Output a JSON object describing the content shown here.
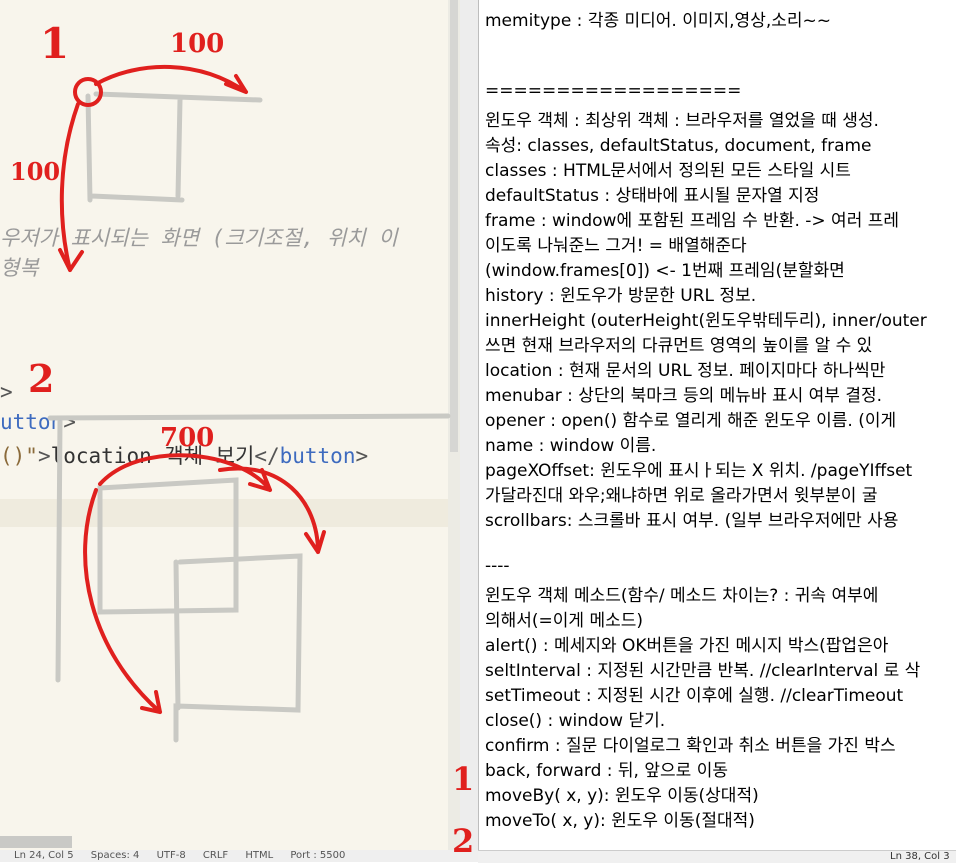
{
  "editor": {
    "comment_line1": "우저가 표시되는 화면 (크기조절, 위치 이",
    "comment_line2": "형복",
    "tag_close_1": ">",
    "code_button": "utton",
    "code_button_suffix": ">",
    "code_line3_prefix": "()\"",
    "code_line3_gt": ">",
    "code_line3_text": "location 객체 보기",
    "code_line3_close": "</",
    "code_line3_tag": "button",
    "code_line3_end": ">"
  },
  "annotations": {
    "mark1": "1",
    "label_100_top": "100",
    "label_100_left": "100",
    "mark2": "2",
    "label_700": "700",
    "mark1_note": "1",
    "mark2_note": "2"
  },
  "editor_status": {
    "position": "Ln 24, Col 5",
    "spaces": "Spaces: 4",
    "encoding": "UTF-8",
    "eol": "CRLF",
    "language": "HTML",
    "port": "Port : 5500"
  },
  "note": {
    "lines": [
      "memitype : 각종 미디어. 이미지,영상,소리~~",
      "",
      "",
      "==================",
      "윈도우 객체 : 최상위 객체 : 브라우저를 열었을 때 생성.",
      "                속성: classes, defaultStatus, document, frame",
      "classes : HTML문서에서 정의된 모든 스타일 시트",
      "defaultStatus : 상태바에 표시될 문자열 지정",
      "frame : window에 포함된 프레임 수 반환. -> 여러 프레",
      "이도록 나눠준느 그거! = 배열해준다",
      "                (window.frames[0]) <- 1번째 프레임(분할화면",
      "history : 윈도우가 방문한 URL 정보.",
      "innerHeight (outerHeight(윈도우밖테두리), inner/outer",
      "쓰면 현재 브라우저의 다큐먼트 영역의 높이를 알 수 있",
      "location : 현재 문서의 URL 정보. 페이지마다 하나씩만",
      "menubar : 상단의 북마크 등의 메뉴바 표시 여부 결정.",
      "opener : open() 함수로 열리게 해준 윈도우 이름. (이게",
      "name : window 이름.",
      "pageXOffset: 윈도우에 표시ㅏ되는 X 위치. /pageYIffset",
      "가달라진대 와우;왜냐하면 위로 올라가면서 윗부분이 굴",
      "scrollbars: 스크롤바 표시 여부. (일부 브라우저에만 사용",
      "",
      "----",
      "윈도우 객체 메소드(함수/ 메소드 차이는? : 귀속 여부에",
      "의해서(=이게 메소드)",
      "alert() : 메세지와 OK버튼을 가진 메시지 박스(팝업은아",
      "seltInterval : 지정된 시간만큼 반복. //clearInterval 로 삭",
      "setTimeout : 지정된 시간 이후에 실행. //clearTimeout",
      "close() : window 닫기.",
      "confirm : 질문 다이얼로그 확인과 취소 버튼을 가진 박스",
      "back, forward : 뒤, 앞으로 이동",
      "moveBy( x, y): 윈도우 이동(상대적)",
      "moveTo( x, y): 윈도우 이동(절대적)"
    ]
  },
  "note_status": {
    "position": "Ln 38, Col 3"
  },
  "colors": {
    "ink": "#e0201e",
    "editor_bg": "#f8f5ec"
  }
}
